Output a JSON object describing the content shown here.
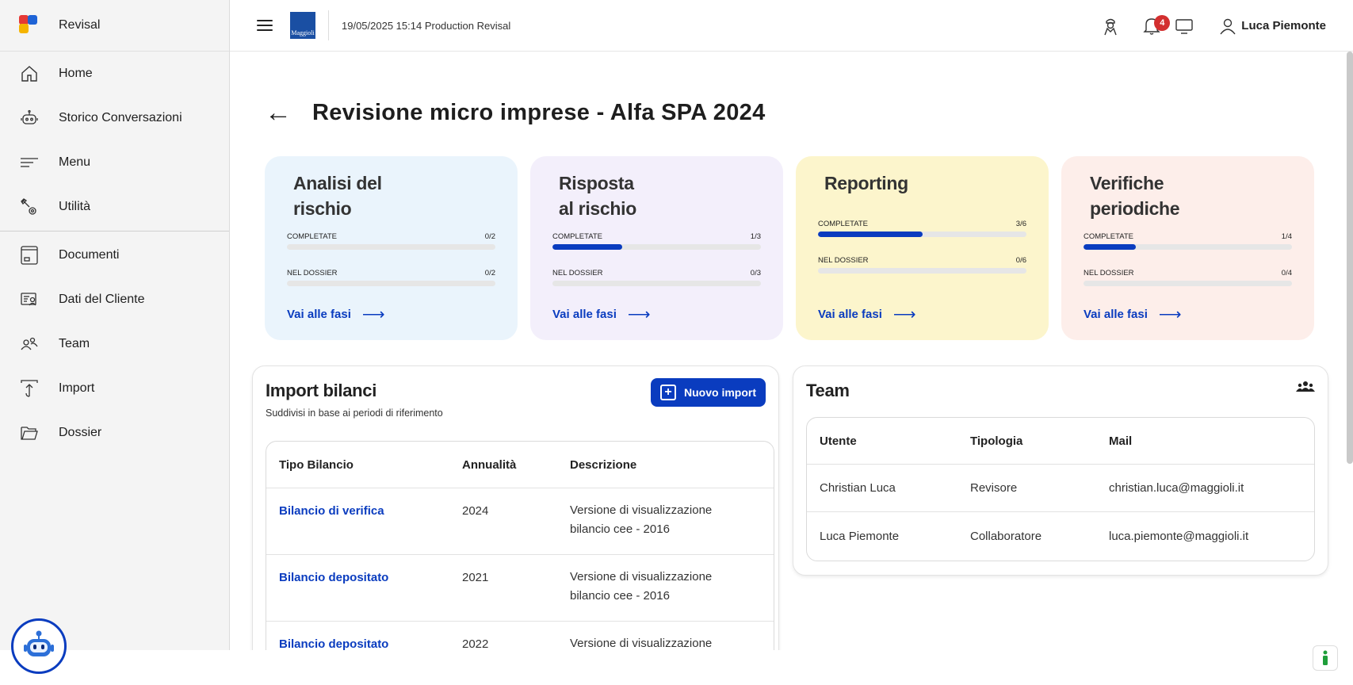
{
  "app": {
    "title": "Revisal"
  },
  "sidebar": {
    "items": [
      {
        "label": "Home",
        "icon": "home-icon"
      },
      {
        "label": "Storico Conversazioni",
        "icon": "robot-icon"
      },
      {
        "label": "Menu",
        "icon": "menu-lines-icon"
      },
      {
        "label": "Utilità",
        "icon": "wrench-gear-icon"
      },
      {
        "label": "Documenti",
        "icon": "document-icon"
      },
      {
        "label": "Dati del Cliente",
        "icon": "client-data-icon"
      },
      {
        "label": "Team",
        "icon": "team-icon"
      },
      {
        "label": "Import",
        "icon": "import-icon"
      },
      {
        "label": "Dossier",
        "icon": "folder-icon"
      }
    ]
  },
  "topbar": {
    "publisher_logo_text": "Maggioli",
    "info": "19/05/2025 15:14 Production Revisal",
    "notifications_count": "4",
    "user_name": "Luca Piemonte"
  },
  "page": {
    "title": "Revisione micro imprese - Alfa SPA 2024"
  },
  "cards": [
    {
      "title_l1": "Analisi del",
      "title_l2": "rischio",
      "bg": "#eaf4fc",
      "r1_label": "COMPLETATE",
      "r1_value": "0/2",
      "r1_progress": 0,
      "r2_label": "NEL DOSSIER",
      "r2_value": "0/2",
      "r2_progress": 0,
      "link": "Vai alle fasi"
    },
    {
      "title_l1": "Risposta",
      "title_l2": "al rischio",
      "bg": "#f3effb",
      "r1_label": "COMPLETATE",
      "r1_value": "1/3",
      "r1_progress": 0.333,
      "r2_label": "NEL DOSSIER",
      "r2_value": "0/3",
      "r2_progress": 0,
      "link": "Vai alle fasi"
    },
    {
      "title_l1": "Reporting",
      "title_l2": "",
      "bg": "#fcf5cc",
      "r1_label": "COMPLETATE",
      "r1_value": "3/6",
      "r1_progress": 0.5,
      "r2_label": "NEL DOSSIER",
      "r2_value": "0/6",
      "r2_progress": 0,
      "link": "Vai alle fasi"
    },
    {
      "title_l1": "Verifiche",
      "title_l2": "periodiche",
      "bg": "#fdeeea",
      "r1_label": "COMPLETATE",
      "r1_value": "1/4",
      "r1_progress": 0.25,
      "r2_label": "NEL DOSSIER",
      "r2_value": "0/4",
      "r2_progress": 0,
      "link": "Vai alle fasi"
    }
  ],
  "import_panel": {
    "title": "Import bilanci",
    "subtitle": "Suddivisi in base ai periodi di riferimento",
    "new_button": "Nuovo import",
    "columns": [
      "Tipo Bilancio",
      "Annualità",
      "Descrizione"
    ],
    "rows": [
      {
        "tipo": "Bilancio di verifica",
        "anno": "2024",
        "desc_l1": "Versione di visualizzazione",
        "desc_l2": "bilancio cee - 2016"
      },
      {
        "tipo": "Bilancio depositato",
        "anno": "2021",
        "desc_l1": "Versione di visualizzazione",
        "desc_l2": "bilancio cee - 2016"
      },
      {
        "tipo": "Bilancio depositato",
        "anno": "2022",
        "desc_l1": "Versione di visualizzazione",
        "desc_l2": ""
      }
    ]
  },
  "team_panel": {
    "title": "Team",
    "columns": [
      "Utente",
      "Tipologia",
      "Mail"
    ],
    "rows": [
      {
        "utente": "Christian Luca",
        "tipologia": "Revisore",
        "mail": "christian.luca@maggioli.it"
      },
      {
        "utente": "Luca Piemonte",
        "tipologia": "Collaboratore",
        "mail": "luca.piemonte@maggioli.it"
      }
    ]
  },
  "colors": {
    "accent": "#0a3cbf",
    "badge": "#d32f2f"
  }
}
